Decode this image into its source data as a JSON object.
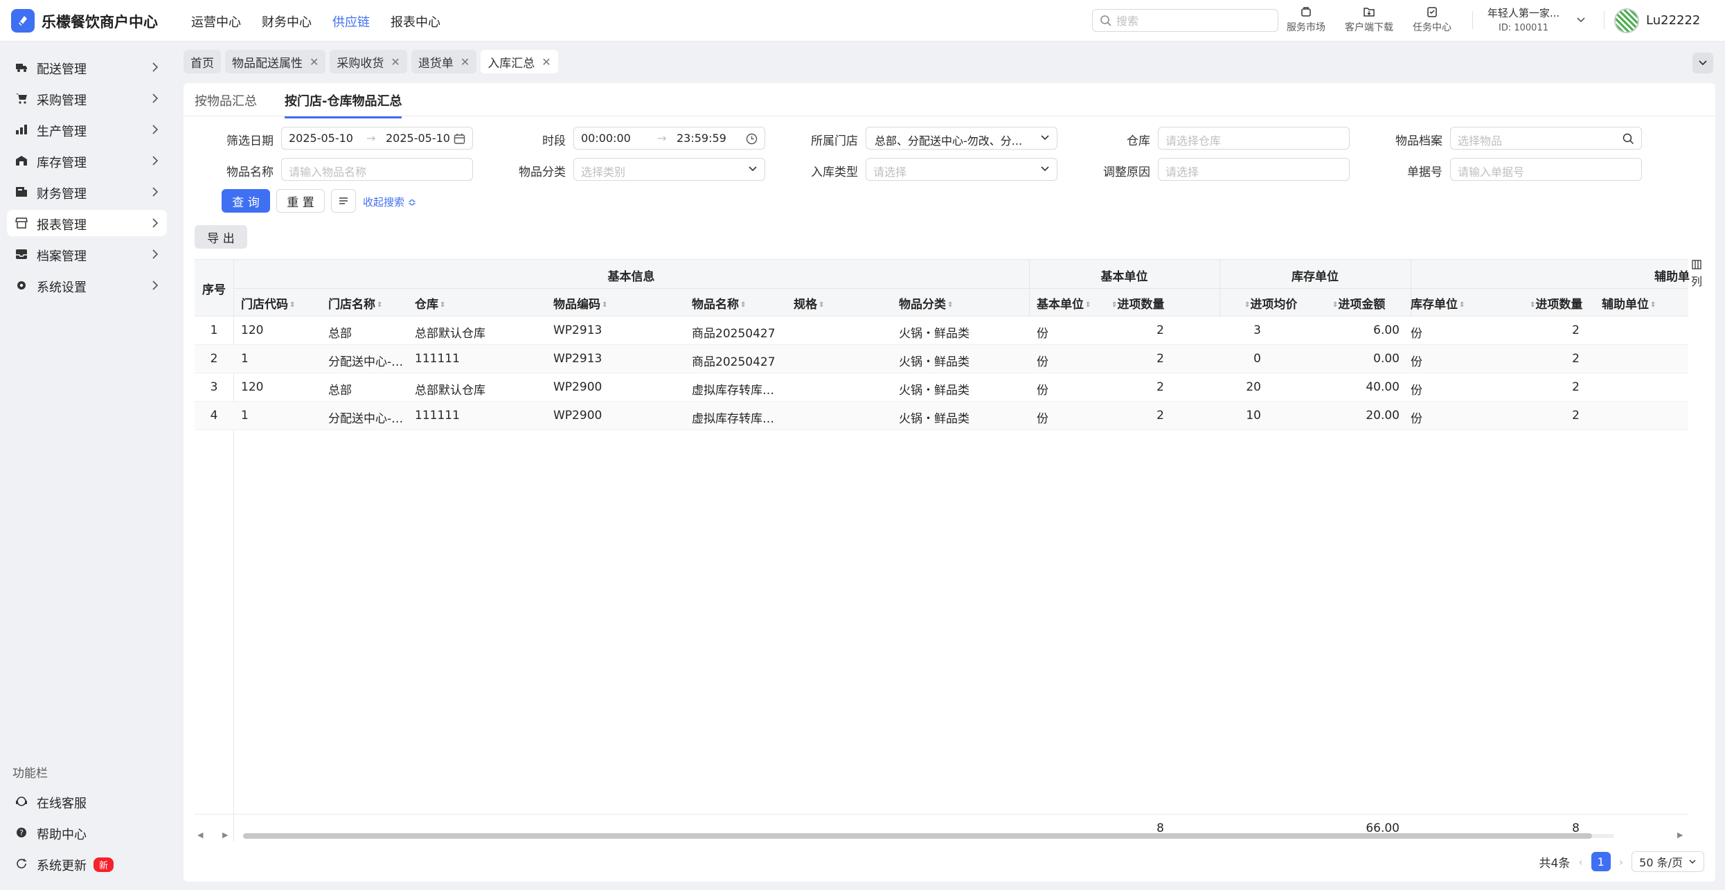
{
  "app": {
    "title": "乐檬餐饮商户中心"
  },
  "topnav": [
    "运营中心",
    "财务中心",
    "供应链",
    "报表中心"
  ],
  "search": {
    "placeholder": "搜索"
  },
  "tools": {
    "market": "服务市场",
    "download": "客户端下载",
    "tasks": "任务中心"
  },
  "account": {
    "name": "年轻人第一家...",
    "id": "ID: 100011",
    "user": "Lu22222"
  },
  "sidebar": {
    "items": [
      "配送管理",
      "采购管理",
      "生产管理",
      "库存管理",
      "财务管理",
      "报表管理",
      "档案管理",
      "系统设置"
    ],
    "func_title": "功能栏",
    "func_items": [
      "在线客服",
      "帮助中心",
      "系统更新"
    ],
    "new_badge": "新"
  },
  "page_tabs": [
    "首页",
    "物品配送属性",
    "采购收货",
    "退货单",
    "入库汇总"
  ],
  "sub_tabs": [
    "按物品汇总",
    "按门店-仓库物品汇总"
  ],
  "filters": {
    "date_label": "筛选日期",
    "date_from": "2025-05-10",
    "date_to": "2025-05-10",
    "time_label": "时段",
    "time_from": "00:00:00",
    "time_to": "23:59:59",
    "store_label": "所属门店",
    "store_value": "总部、分配送中心-勿改、分...",
    "warehouse_label": "仓库",
    "warehouse_ph": "请选择仓库",
    "item_label": "物品档案",
    "item_ph": "选择物品",
    "name_label": "物品名称",
    "name_ph": "请输入物品名称",
    "cat_label": "物品分类",
    "cat_ph": "选择类别",
    "type_label": "入库类型",
    "type_ph": "请选择",
    "reason_label": "调整原因",
    "reason_ph": "请选择",
    "bill_label": "单据号",
    "bill_ph": "请输入单据号"
  },
  "buttons": {
    "query": "查 询",
    "reset": "重 置",
    "collapse": "收起搜索",
    "export": "导 出"
  },
  "table": {
    "groups": {
      "basic": "基本信息",
      "base_unit": "基本单位",
      "stock_unit": "库存单位",
      "aux_unit": "辅助单"
    },
    "headers": {
      "seq": "序号",
      "store_code": "门店代码",
      "store_name": "门店名称",
      "warehouse": "仓库",
      "item_code": "物品编码",
      "item_name": "物品名称",
      "spec": "规格",
      "category": "物品分类",
      "base_unit": "基本单位",
      "in_qty": "进项数量",
      "in_avg": "进项均价",
      "in_amt": "进项金额",
      "stock_unit": "库存单位",
      "stock_qty": "进项数量",
      "aux_unit": "辅助单位"
    },
    "col_setting": "列",
    "rows": [
      {
        "seq": "1",
        "store_code": "120",
        "store_name": "总部",
        "warehouse": "总部默认仓库",
        "item_code": "WP2913",
        "item_name": "商品20250427",
        "spec": "",
        "category": "火锅・鲜品类",
        "base_unit": "份",
        "in_qty": "2",
        "in_avg": "3",
        "in_amt": "6.00",
        "stock_unit": "份",
        "stock_qty": "2"
      },
      {
        "seq": "2",
        "store_code": "1",
        "store_name": "分配送中心-勿改",
        "warehouse": "111111",
        "item_code": "WP2913",
        "item_name": "商品20250427",
        "spec": "",
        "category": "火锅・鲜品类",
        "base_unit": "份",
        "in_qty": "2",
        "in_avg": "0",
        "in_amt": "0.00",
        "stock_unit": "份",
        "stock_qty": "2"
      },
      {
        "seq": "3",
        "store_code": "120",
        "store_name": "总部",
        "warehouse": "总部默认仓库",
        "item_code": "WP2900",
        "item_name": "虚拟库存转库存物品",
        "spec": "",
        "category": "火锅・鲜品类",
        "base_unit": "份",
        "in_qty": "2",
        "in_avg": "20",
        "in_amt": "40.00",
        "stock_unit": "份",
        "stock_qty": "2"
      },
      {
        "seq": "4",
        "store_code": "1",
        "store_name": "分配送中心-勿改",
        "warehouse": "111111",
        "item_code": "WP2900",
        "item_name": "虚拟库存转库存物品",
        "spec": "",
        "category": "火锅・鲜品类",
        "base_unit": "份",
        "in_qty": "2",
        "in_avg": "10",
        "in_amt": "20.00",
        "stock_unit": "份",
        "stock_qty": "2"
      }
    ],
    "summary": {
      "in_qty": "8",
      "in_amt": "66.00",
      "stock_qty": "8"
    }
  },
  "pager": {
    "total": "共4条",
    "page": "1",
    "size": "50 条/页"
  },
  "colors": {
    "accent": "#3f6ff2",
    "badge": "#f5222d"
  }
}
